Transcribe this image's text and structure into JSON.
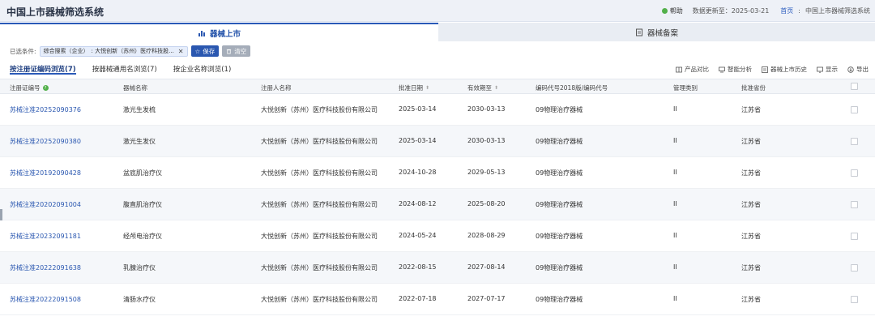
{
  "app": {
    "title": "中国上市器械筛选系统"
  },
  "header": {
    "help_label": "帮助",
    "update_label": "数据更新至：2025-03-21",
    "breadcrumb_home": "首页",
    "breadcrumb_sep": ":",
    "breadcrumb_current": "中国上市器械筛选系统"
  },
  "tabs": [
    {
      "label": "器械上市",
      "icon": "bar-chart-icon",
      "active": true
    },
    {
      "label": "器械备案",
      "icon": "document-icon",
      "active": false
    }
  ],
  "filter": {
    "label": "已选条件:",
    "chip_type": "综合搜索（企业）",
    "chip_value": ": 大悦创新（苏州）医疗科技股...",
    "save_label": "保存",
    "clear_label": "清空"
  },
  "subtabs": [
    {
      "label": "按注册证编码浏览(7)",
      "active": true
    },
    {
      "label": "按器械通用名浏览(7)",
      "active": false
    },
    {
      "label": "按企业名称浏览(1)",
      "active": false
    }
  ],
  "toolbar": {
    "compare": "产品对比",
    "analysis": "智能分析",
    "history": "器械上市历史",
    "display": "显示",
    "export": "导出"
  },
  "table": {
    "columns": {
      "reg_no": "注册证编号",
      "name": "器械名称",
      "registrant": "注册人名称",
      "approve_date": "批准日期",
      "valid_until": "有效期至",
      "category_code": "编码代号2018版/编码代号",
      "class": "管理类别",
      "province": "批准省份"
    },
    "rows": [
      {
        "reg_no": "苏械注准20252090376",
        "name": "激光生发梳",
        "registrant": "大悦创新（苏州）医疗科技股份有限公司",
        "approve_date": "2025-03-14",
        "valid_until": "2030-03-13",
        "category_code": "09物理治疗器械",
        "class": "II",
        "province": "江苏省"
      },
      {
        "reg_no": "苏械注准20252090380",
        "name": "激光生发仪",
        "registrant": "大悦创新（苏州）医疗科技股份有限公司",
        "approve_date": "2025-03-14",
        "valid_until": "2030-03-13",
        "category_code": "09物理治疗器械",
        "class": "II",
        "province": "江苏省"
      },
      {
        "reg_no": "苏械注准20192090428",
        "name": "盆底肌治疗仪",
        "registrant": "大悦创新（苏州）医疗科技股份有限公司",
        "approve_date": "2024-10-28",
        "valid_until": "2029-05-13",
        "category_code": "09物理治疗器械",
        "class": "II",
        "province": "江苏省"
      },
      {
        "reg_no": "苏械注准20202091004",
        "name": "腹直肌治疗仪",
        "registrant": "大悦创新（苏州）医疗科技股份有限公司",
        "approve_date": "2024-08-12",
        "valid_until": "2025-08-20",
        "category_code": "09物理治疗器械",
        "class": "II",
        "province": "江苏省"
      },
      {
        "reg_no": "苏械注准20232091181",
        "name": "经颅电治疗仪",
        "registrant": "大悦创新（苏州）医疗科技股份有限公司",
        "approve_date": "2024-05-24",
        "valid_until": "2028-08-29",
        "category_code": "09物理治疗器械",
        "class": "II",
        "province": "江苏省"
      },
      {
        "reg_no": "苏械注准20222091638",
        "name": "乳腺治疗仪",
        "registrant": "大悦创新（苏州）医疗科技股份有限公司",
        "approve_date": "2022-08-15",
        "valid_until": "2027-08-14",
        "category_code": "09物理治疗器械",
        "class": "II",
        "province": "江苏省"
      },
      {
        "reg_no": "苏械注准20222091508",
        "name": "清肠水疗仪",
        "registrant": "大悦创新（苏州）医疗科技股份有限公司",
        "approve_date": "2022-07-18",
        "valid_until": "2027-07-17",
        "category_code": "09物理治疗器械",
        "class": "II",
        "province": "江苏省"
      }
    ]
  },
  "colors": {
    "accent": "#2a57b0",
    "help_dot": "#52b04a",
    "clear_button": "#a5adb9"
  }
}
